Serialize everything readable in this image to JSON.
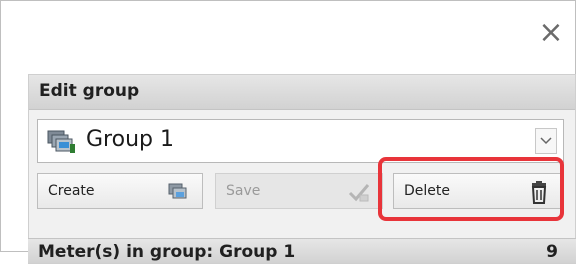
{
  "dialog": {
    "close_label": "×"
  },
  "edit_group": {
    "title": "Edit group",
    "selected_group": "Group 1",
    "group_icon": "group-icon",
    "dropdown_icon": "chevron-down-icon",
    "buttons": {
      "create": {
        "label": "Create",
        "icon": "create-group-icon",
        "enabled": true
      },
      "save": {
        "label": "Save",
        "icon": "save-check-icon",
        "enabled": false
      },
      "delete": {
        "label": "Delete",
        "icon": "trash-icon",
        "enabled": true
      }
    }
  },
  "meters_section": {
    "title": "Meter(s) in group: Group 1",
    "count": "9"
  },
  "colors": {
    "highlight": "#e8343a",
    "header_bg": "#d9d9d9"
  }
}
